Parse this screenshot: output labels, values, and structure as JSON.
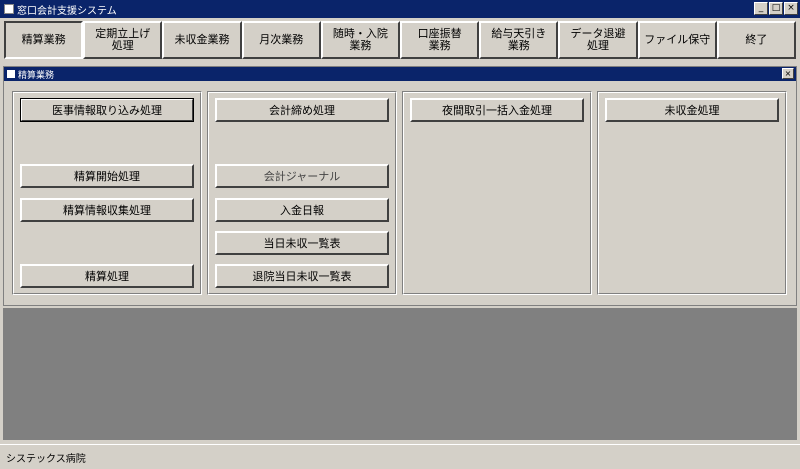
{
  "app": {
    "title": "窓口会計支援システム"
  },
  "window_buttons": {
    "minimize": "_",
    "maximize": "□",
    "close": "×"
  },
  "menu": [
    "精算業務",
    "定期立上げ\n処理",
    "未収金業務",
    "月次業務",
    "随時・入院\n業務",
    "口座振替\n業務",
    "給与天引き\n業務",
    "データ退避\n処理",
    "ファイル保守",
    "終了"
  ],
  "subwindow": {
    "title": "精算業務",
    "close": "×"
  },
  "panels": {
    "p1": {
      "import": "医事情報取り込み処理",
      "start": "精算開始処理",
      "collect": "精算情報収集処理",
      "process": "精算処理"
    },
    "p2": {
      "close_accounts": "会計締め処理",
      "journal": "会計ジャーナル",
      "daily_payment": "入金日報",
      "today_unpaid": "当日未収一覧表",
      "discharge_unpaid": "退院当日未収一覧表"
    },
    "p3": {
      "bulk_payment": "夜間取引一括入金処理"
    },
    "p4": {
      "unpaid_process": "未収金処理"
    }
  },
  "status": {
    "text": "システックス病院"
  }
}
